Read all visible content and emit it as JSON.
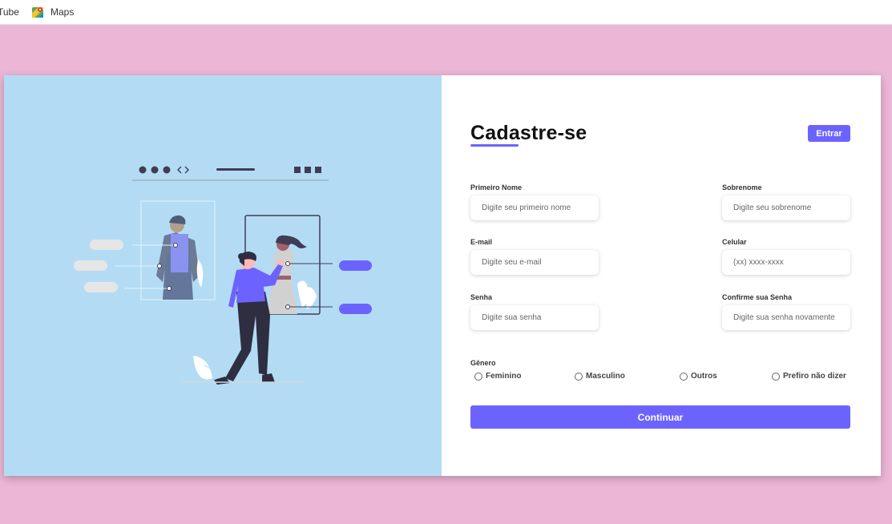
{
  "bookmarks": [
    {
      "label": "Tube",
      "icon": "youtube-icon"
    },
    {
      "label": "Maps",
      "icon": "maps-icon"
    }
  ],
  "colors": {
    "page_bg": "#ecb6d6",
    "left_panel_bg": "#b3dcf4",
    "accent": "#6c63ff"
  },
  "form": {
    "title": "Cadastre-se",
    "login_button": "Entrar",
    "fields": {
      "first_name": {
        "label": "Primeiro Nome",
        "placeholder": "Digite seu primeiro nome"
      },
      "last_name": {
        "label": "Sobrenome",
        "placeholder": "Digite seu sobrenome"
      },
      "email": {
        "label": "E-mail",
        "placeholder": "Digite seu e-mail"
      },
      "phone": {
        "label": "Celular",
        "placeholder": "(xx) xxxx-xxxx"
      },
      "password": {
        "label": "Senha",
        "placeholder": "Digite sua senha"
      },
      "confirm_password": {
        "label": "Confirme sua Senha",
        "placeholder": "Digite sua senha novamente"
      }
    },
    "gender": {
      "label": "Gênero",
      "options": [
        "Feminino",
        "Masculino",
        "Outros",
        "Prefiro não dizer"
      ]
    },
    "submit_button": "Continuar"
  }
}
